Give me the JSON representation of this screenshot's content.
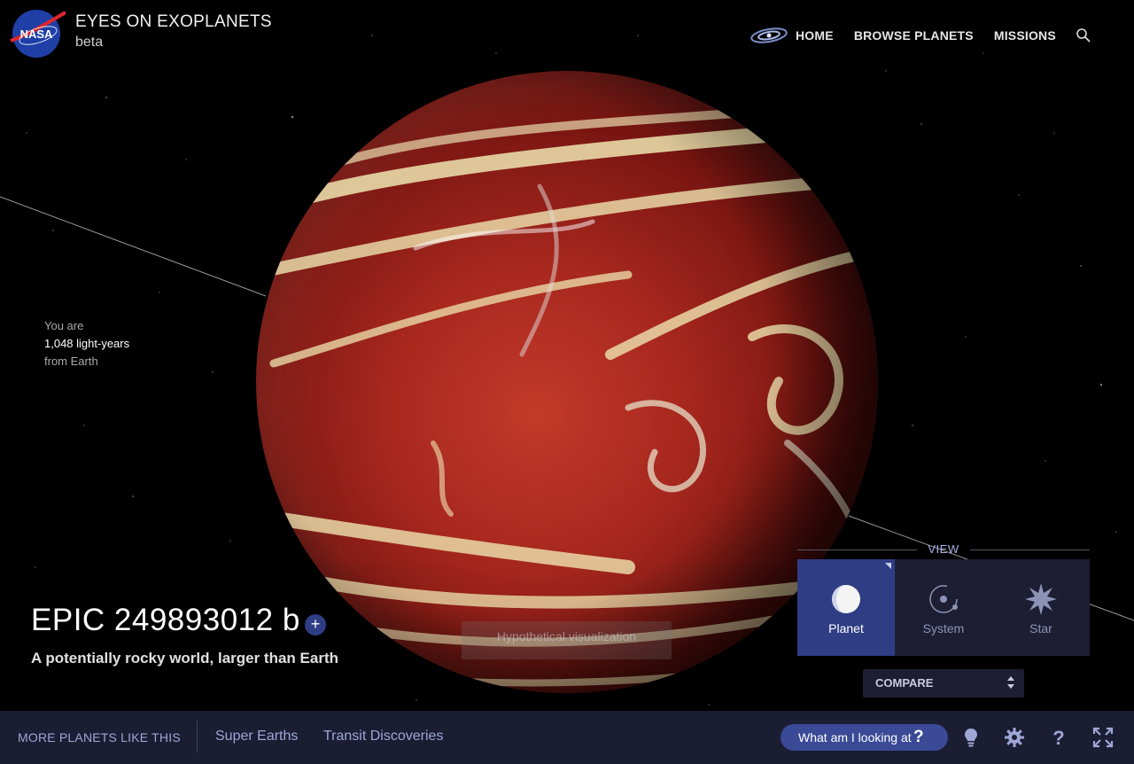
{
  "header": {
    "brand_title": "EYES ON EXOPLANETS",
    "brand_sub": "beta",
    "logo_icon": "nasa-meatball-logo",
    "nav": {
      "galaxy_icon": "galaxy-icon",
      "home": "HOME",
      "browse": "BROWSE PLANETS",
      "missions": "MISSIONS",
      "search_icon": "search-icon"
    }
  },
  "distance": {
    "line1": "You are",
    "value": "1,048 light-years",
    "line3": "from Earth"
  },
  "planet": {
    "name": "EPIC 249893012 b",
    "add_label": "+",
    "description": "A potentially rocky world, larger than Earth",
    "visualization_note": "Hypothetical visualization"
  },
  "view": {
    "label": "VIEW",
    "options": [
      {
        "label": "Planet",
        "icon": "planet-icon",
        "active": true
      },
      {
        "label": "System",
        "icon": "system-orbit-icon",
        "active": false
      },
      {
        "label": "Star",
        "icon": "star-burst-icon",
        "active": false
      }
    ]
  },
  "compare": {
    "label": "COMPARE",
    "icon": "select-arrows-icon"
  },
  "bottom": {
    "title": "MORE PLANETS LIKE THIS",
    "links": [
      "Super Earths",
      "Transit Discoveries"
    ],
    "looking_label": "What am I looking at",
    "looking_q": "?",
    "icons": [
      "lightbulb-icon",
      "gear-icon",
      "help-icon",
      "fullscreen-icon"
    ]
  },
  "colors": {
    "accent": "#2f3d84",
    "panel": "#1d1e33",
    "bar": "#1b1d33",
    "link": "#9ea7d6"
  }
}
